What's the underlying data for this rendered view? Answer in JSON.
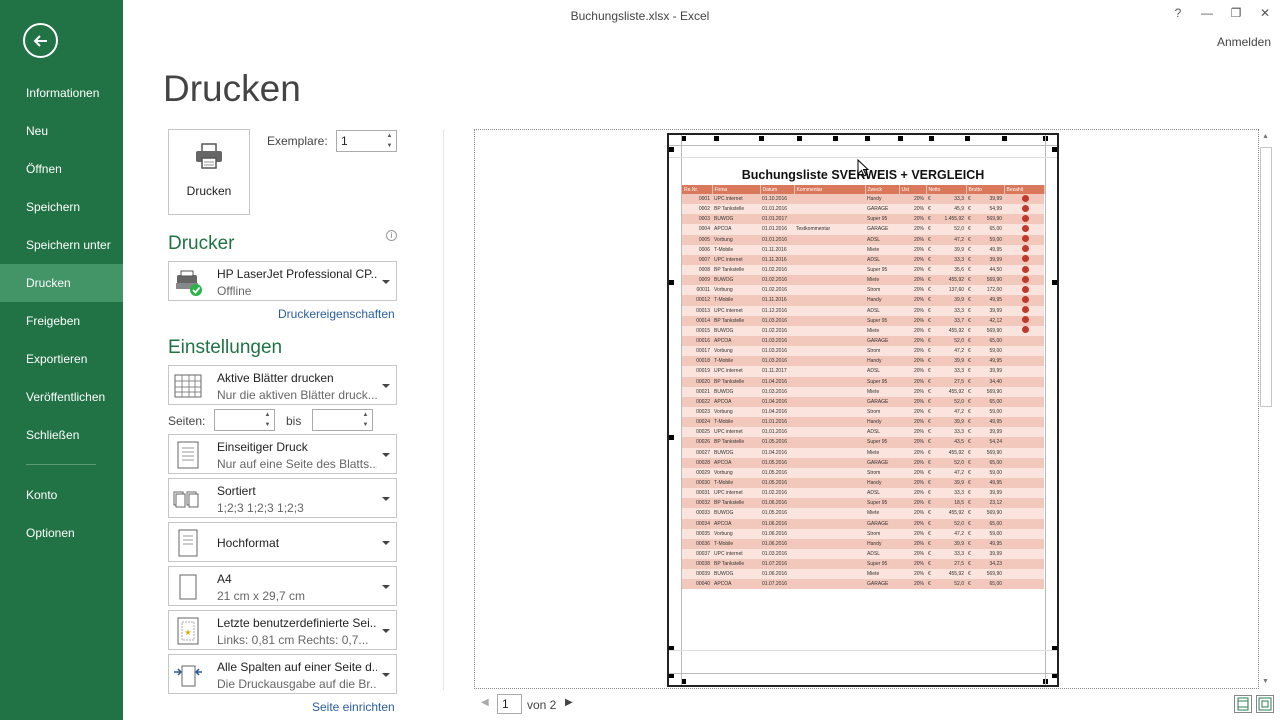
{
  "window": {
    "title": "Buchungsliste.xlsx - Excel",
    "help": "?",
    "minimize": "—",
    "restore": "❐",
    "close": "✕",
    "signin": "Anmelden"
  },
  "sidebar": {
    "back": "back",
    "items": [
      {
        "label": "Informationen"
      },
      {
        "label": "Neu"
      },
      {
        "label": "Öffnen"
      },
      {
        "label": "Speichern"
      },
      {
        "label": "Speichern unter"
      },
      {
        "label": "Drucken",
        "active": true
      },
      {
        "label": "Freigeben"
      },
      {
        "label": "Exportieren"
      },
      {
        "label": "Veröffentlichen"
      },
      {
        "label": "Schließen"
      },
      {
        "label": "Konto"
      },
      {
        "label": "Optionen"
      }
    ]
  },
  "print": {
    "page_title": "Drucken",
    "button_label": "Drucken",
    "copies_label": "Exemplare:",
    "copies_value": "1"
  },
  "printer": {
    "heading": "Drucker",
    "name": "HP LaserJet Professional CP...",
    "status": "Offline",
    "properties_link": "Druckereigenschaften"
  },
  "settings": {
    "heading": "Einstellungen",
    "scope": {
      "title": "Aktive Blätter drucken",
      "sub": "Nur die aktiven Blätter druck..."
    },
    "pages_label": "Seiten:",
    "pages_to": "bis",
    "pages_from_value": "",
    "pages_to_value": "",
    "sides": {
      "title": "Einseitiger Druck",
      "sub": "Nur auf eine Seite des Blatts..."
    },
    "collate": {
      "title": "Sortiert",
      "sub": "1;2;3    1;2;3    1;2;3"
    },
    "orientation": {
      "title": "Hochformat"
    },
    "paper": {
      "title": "A4",
      "sub": "21   cm x 29,7   cm"
    },
    "margins": {
      "title": "Letzte benutzerdefinierte Sei...",
      "sub": "Links: 0,81   cm    Rechts: 0,7..."
    },
    "scaling": {
      "title": "Alle Spalten auf einer Seite d...",
      "sub": "Die Druckausgabe auf die Br..."
    },
    "page_setup_link": "Seite einrichten"
  },
  "preview": {
    "sheet_title": "Buchungsliste SVERWEIS + VERGLEICH",
    "headers": [
      "Re.Nr.",
      "Firma",
      "Datum",
      "Kommentar",
      "Zweck",
      "Ust",
      "Netto",
      "Brutto",
      "Bezahlt"
    ],
    "rows": [
      [
        "0001",
        "UPC internet",
        "01.10.2016",
        "",
        "Handy",
        "20%",
        "€",
        "33,3",
        "€",
        "39,99",
        true
      ],
      [
        "0002",
        "BP Tankstelle",
        "01.01.2016",
        "",
        "GARAGE",
        "20%",
        "€",
        "45,9",
        "€",
        "54,99",
        true
      ],
      [
        "0003",
        "BUWOG",
        "01.01.2017",
        "",
        "Super 95",
        "20%",
        "€",
        "1.455,92",
        "€",
        "569,90",
        true
      ],
      [
        "0004",
        "APCOA",
        "01.01.2016",
        "Testkommentar",
        "GARAGE",
        "20%",
        "€",
        "52,0",
        "€",
        "65,00",
        true
      ],
      [
        "0005",
        "Vorbung",
        "01.01.2016",
        "",
        "ADSL",
        "20%",
        "€",
        "47,2",
        "€",
        "59,00",
        true
      ],
      [
        "0006",
        "T-Mobile",
        "01.11.2016",
        "",
        "Miete",
        "20%",
        "€",
        "39,9",
        "€",
        "49,95",
        true
      ],
      [
        "0007",
        "UPC internet",
        "01.11.2016",
        "",
        "ADSL",
        "20%",
        "€",
        "33,3",
        "€",
        "39,99",
        true
      ],
      [
        "0008",
        "BP Tankstelle",
        "01.02.2016",
        "",
        "Super 95",
        "20%",
        "€",
        "35,6",
        "€",
        "44,50",
        true
      ],
      [
        "0009",
        "BUWOG",
        "01.02.2016",
        "",
        "Miete",
        "20%",
        "€",
        "455,92",
        "€",
        "569,90",
        true
      ],
      [
        "00011",
        "Vorbung",
        "01.02.2016",
        "",
        "Strom",
        "20%",
        "€",
        "137,60",
        "€",
        "172,00",
        true
      ],
      [
        "00012",
        "T-Mobile",
        "01.11.2016",
        "",
        "Handy",
        "20%",
        "€",
        "39,9",
        "€",
        "49,95",
        true
      ],
      [
        "00013",
        "UPC internet",
        "01.12.2016",
        "",
        "ADSL",
        "20%",
        "€",
        "33,3",
        "€",
        "39,99",
        true
      ],
      [
        "00014",
        "BP Tankstelle",
        "01.03.2016",
        "",
        "Super 95",
        "20%",
        "€",
        "33,7",
        "€",
        "42,12",
        true
      ],
      [
        "00015",
        "BUWOG",
        "01.02.2016",
        "",
        "Miete",
        "20%",
        "€",
        "455,92",
        "€",
        "569,90",
        true
      ],
      [
        "00016",
        "APCOA",
        "01.03.2016",
        "",
        "GARAGE",
        "20%",
        "€",
        "52,0",
        "€",
        "65,00",
        false
      ],
      [
        "00017",
        "Vorbung",
        "01.03.2016",
        "",
        "Strom",
        "20%",
        "€",
        "47,2",
        "€",
        "59,00",
        false
      ],
      [
        "00018",
        "T-Mobile",
        "01.03.2016",
        "",
        "Handy",
        "20%",
        "€",
        "39,9",
        "€",
        "49,95",
        false
      ],
      [
        "00019",
        "UPC internet",
        "01.11.2017",
        "",
        "ADSL",
        "20%",
        "€",
        "33,3",
        "€",
        "39,99",
        false
      ],
      [
        "00020",
        "BP Tankstelle",
        "01.04.2016",
        "",
        "Super 95",
        "20%",
        "€",
        "27,5",
        "€",
        "34,40",
        false
      ],
      [
        "00021",
        "BUWOG",
        "01.03.2016",
        "",
        "Miete",
        "20%",
        "€",
        "455,92",
        "€",
        "569,90",
        false
      ],
      [
        "00022",
        "APCOA",
        "01.04.2016",
        "",
        "GARAGE",
        "20%",
        "€",
        "52,0",
        "€",
        "65,00",
        false
      ],
      [
        "00023",
        "Vorbung",
        "01.04.2016",
        "",
        "Strom",
        "20%",
        "€",
        "47,2",
        "€",
        "59,00",
        false
      ],
      [
        "00024",
        "T-Mobile",
        "01.01.2016",
        "",
        "Handy",
        "20%",
        "€",
        "39,9",
        "€",
        "49,95",
        false
      ],
      [
        "00025",
        "UPC internet",
        "01.01.2016",
        "",
        "ADSL",
        "20%",
        "€",
        "33,3",
        "€",
        "39,99",
        false
      ],
      [
        "00026",
        "BP Tankstelle",
        "01.05.2016",
        "",
        "Super 95",
        "20%",
        "€",
        "43,5",
        "€",
        "54,24",
        false
      ],
      [
        "00027",
        "BUWOG",
        "01.04.2016",
        "",
        "Miete",
        "20%",
        "€",
        "455,92",
        "€",
        "569,90",
        false
      ],
      [
        "00028",
        "APCOA",
        "01.05.2016",
        "",
        "GARAGE",
        "20%",
        "€",
        "52,0",
        "€",
        "65,00",
        false
      ],
      [
        "00029",
        "Vorbung",
        "01.05.2016",
        "",
        "Strom",
        "20%",
        "€",
        "47,2",
        "€",
        "59,00",
        false
      ],
      [
        "00030",
        "T-Mobile",
        "01.05.2016",
        "",
        "Handy",
        "20%",
        "€",
        "39,9",
        "€",
        "49,95",
        false
      ],
      [
        "00031",
        "UPC internet",
        "01.02.2016",
        "",
        "ADSL",
        "20%",
        "€",
        "33,3",
        "€",
        "39,99",
        false
      ],
      [
        "00032",
        "BP Tankstelle",
        "01.06.2016",
        "",
        "Super 95",
        "20%",
        "€",
        "18,5",
        "€",
        "23,12",
        false
      ],
      [
        "00033",
        "BUWOG",
        "01.05.2016",
        "",
        "Miete",
        "20%",
        "€",
        "455,92",
        "€",
        "569,90",
        false
      ],
      [
        "00034",
        "APCOA",
        "01.06.2016",
        "",
        "GARAGE",
        "20%",
        "€",
        "52,0",
        "€",
        "65,00",
        false
      ],
      [
        "00035",
        "Vorbung",
        "01.06.2016",
        "",
        "Strom",
        "20%",
        "€",
        "47,2",
        "€",
        "59,00",
        false
      ],
      [
        "00036",
        "T-Mobile",
        "01.06.2016",
        "",
        "Handy",
        "20%",
        "€",
        "39,9",
        "€",
        "49,95",
        false
      ],
      [
        "00037",
        "UPC internet",
        "01.03.2016",
        "",
        "ADSL",
        "20%",
        "€",
        "33,3",
        "€",
        "39,99",
        false
      ],
      [
        "00038",
        "BP Tankstelle",
        "01.07.2016",
        "",
        "Super 95",
        "20%",
        "€",
        "27,5",
        "€",
        "34,23",
        false
      ],
      [
        "00039",
        "BUWOG",
        "01.06.2016",
        "",
        "Miete",
        "20%",
        "€",
        "455,92",
        "€",
        "569,90",
        false
      ],
      [
        "00040",
        "APCOA",
        "01.07.2016",
        "",
        "GARAGE",
        "20%",
        "€",
        "52,0",
        "€",
        "65,00",
        false
      ]
    ]
  },
  "pagenav": {
    "current": "1",
    "of": "von 2",
    "prev": "◀",
    "next": "▶"
  },
  "colors": {
    "accent": "#217346",
    "header_row": "#d9785a",
    "paid_dot": "#c0392b"
  }
}
